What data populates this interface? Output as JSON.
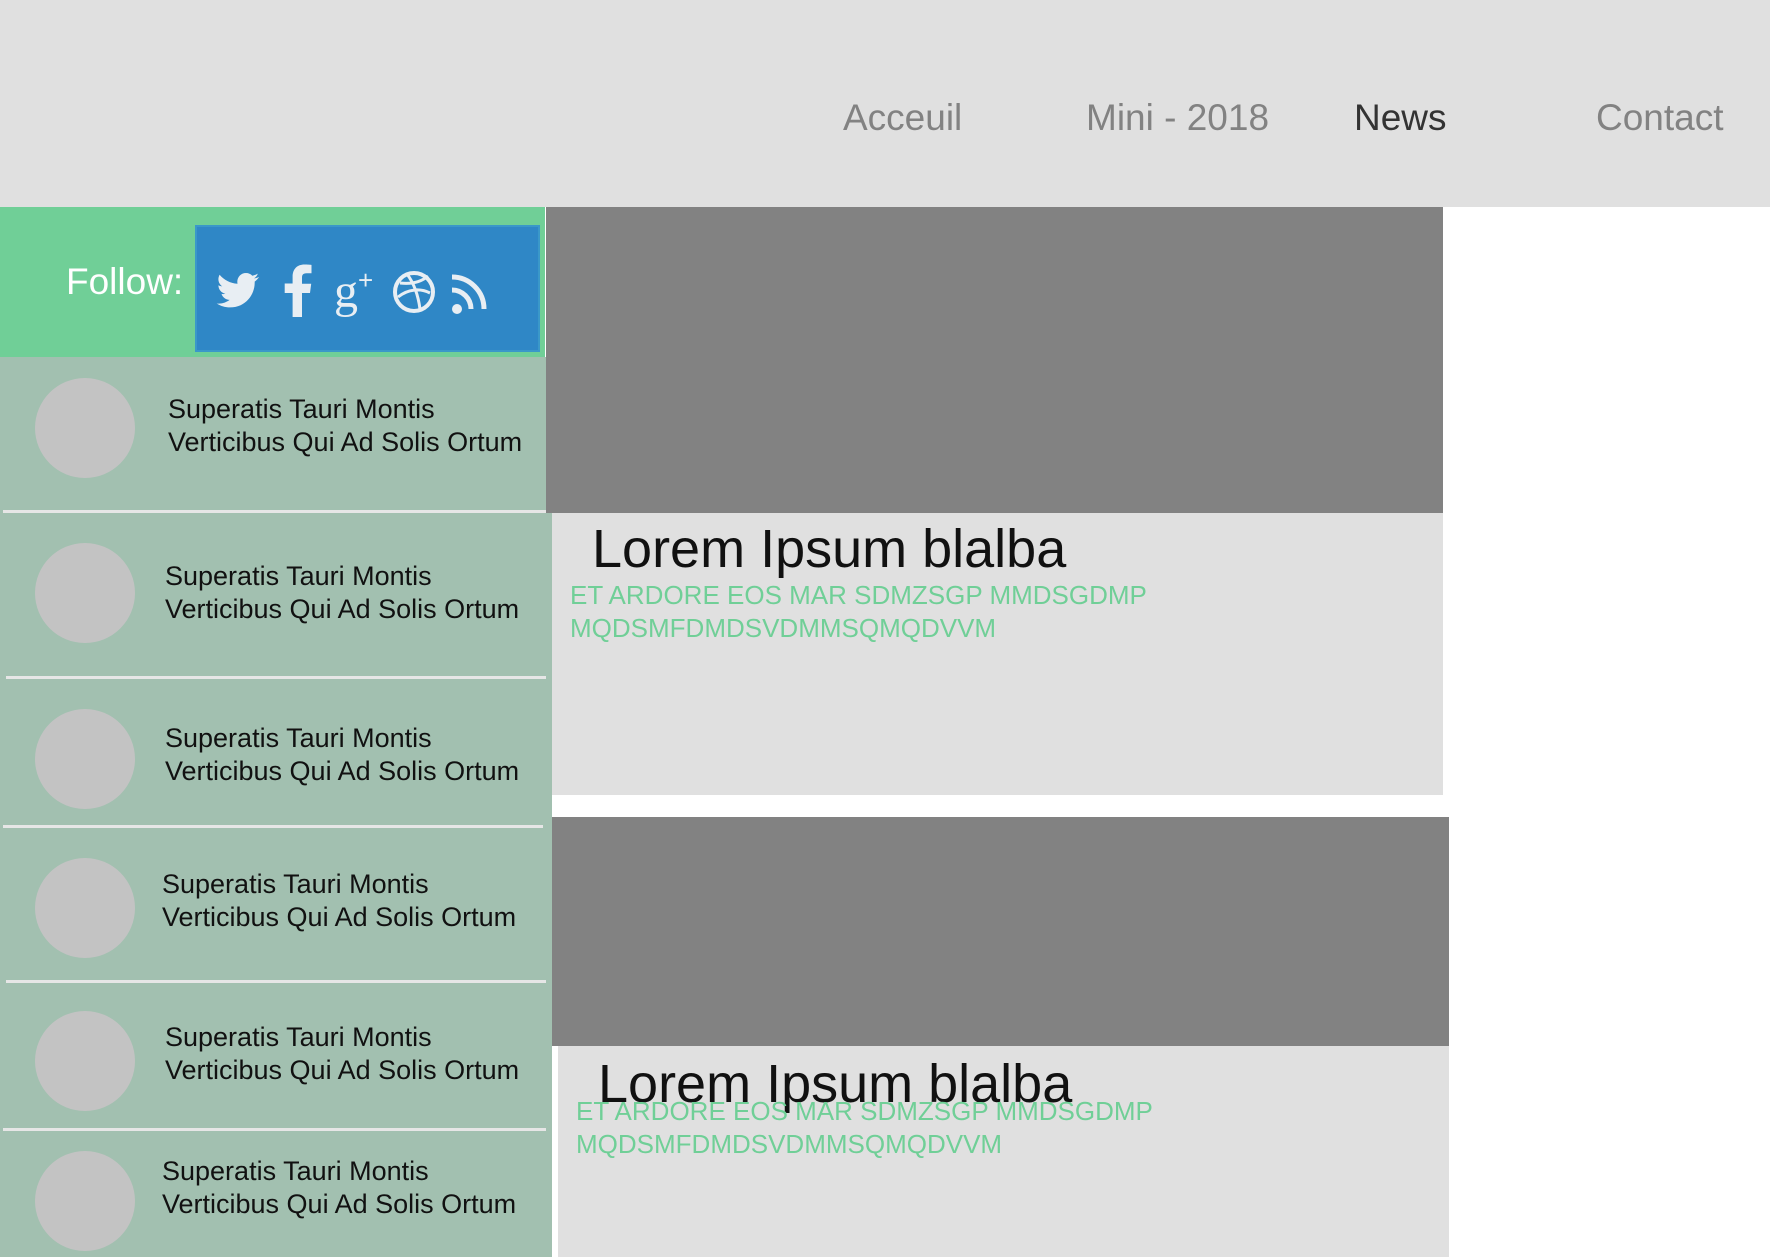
{
  "nav": {
    "items": [
      {
        "label": "Acceuil",
        "active": false
      },
      {
        "label": "Mini - 2018",
        "active": false
      },
      {
        "label": "News",
        "active": true
      },
      {
        "label": "Contact",
        "active": false
      }
    ]
  },
  "follow": {
    "label": "Follow:",
    "icons": [
      "twitter-icon",
      "facebook-icon",
      "google-plus-icon",
      "dribbble-icon",
      "rss-icon"
    ]
  },
  "sidebar": {
    "items": [
      {
        "line1": "Superatis Tauri Montis",
        "line2": "Verticibus Qui Ad Solis Ortum"
      },
      {
        "line1": "Superatis Tauri Montis",
        "line2": "Verticibus Qui Ad Solis Ortum"
      },
      {
        "line1": "Superatis Tauri Montis",
        "line2": "Verticibus Qui Ad Solis Ortum"
      },
      {
        "line1": "Superatis Tauri Montis",
        "line2": "Verticibus Qui Ad Solis Ortum"
      },
      {
        "line1": "Superatis Tauri Montis",
        "line2": "Verticibus Qui Ad Solis Ortum"
      },
      {
        "line1": "Superatis Tauri Montis",
        "line2": "Verticibus Qui Ad Solis Ortum"
      }
    ]
  },
  "articles": [
    {
      "title": "Lorem Ipsum blalba",
      "excerpt_line1": "ET ARDORE EOS MAR SDMZSGP MMDSGDMP",
      "excerpt_line2": "MQDSMFDMDSVDMMSQMQDVVM"
    },
    {
      "title": "Lorem Ipsum blalba",
      "excerpt_line1": "ET ARDORE EOS MAR SDMZSGP MMDSGDMP",
      "excerpt_line2": "MQDSMFDMDSVDMMSQMQDVVM"
    }
  ],
  "colors": {
    "header_bg": "#e0e0e0",
    "nav_text": "#828282",
    "nav_active": "#333333",
    "follow_green": "#70cf97",
    "social_blue": "#2f87c6",
    "sidebar_bg": "#a2c0b0",
    "avatar": "#c3c3c3",
    "image_placeholder": "#828282",
    "excerpt_green": "#70cf97"
  }
}
